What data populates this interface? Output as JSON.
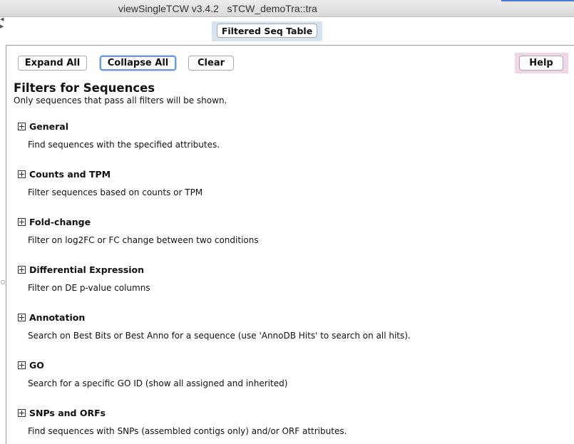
{
  "window": {
    "title": "viewSingleTCW v3.4.2   sTCW_demoTra::tra"
  },
  "tabs": {
    "active_label": "Filtered Seq Table"
  },
  "toolbar": {
    "expand_label": "Expand All",
    "collapse_label": "Collapse All",
    "clear_label": "Clear",
    "help_label": "Help"
  },
  "filters": {
    "title": "Filters for Sequences",
    "subtitle": "Only sequences that pass all filters will be shown.",
    "sections": [
      {
        "title": "General",
        "description": "Find sequences with the specified attributes."
      },
      {
        "title": "Counts and TPM",
        "description": "Filter sequences based on counts or TPM"
      },
      {
        "title": "Fold-change",
        "description": "Filter on log2FC or FC change between two conditions"
      },
      {
        "title": "Differential Expression",
        "description": "Filter on DE p-value columns"
      },
      {
        "title": "Annotation",
        "description": "Search on Best Bits or Best Anno for a sequence (use 'AnnoDB Hits' to search on all hits)."
      },
      {
        "title": "GO",
        "description": "Search for a specific GO ID (show all assigned and inherited)"
      },
      {
        "title": "SNPs and ORFs",
        "description": "Find sequences with SNPs (assembled contigs only) and/or ORF attributes."
      }
    ]
  },
  "icons": {
    "expand": "plus-square-icon"
  }
}
